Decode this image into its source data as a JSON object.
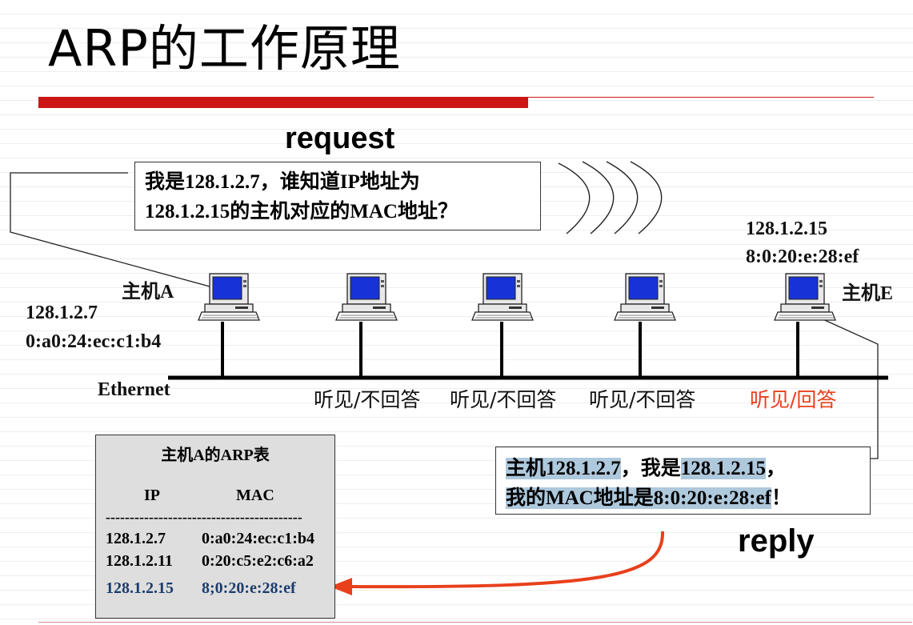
{
  "title": "ARP的工作原理",
  "request_label": "request",
  "reply_label": "reply",
  "request_message": {
    "line1": "我是128.1.2.7，谁知道IP地址为",
    "line2": "128.1.2.15的主机对应的MAC地址？"
  },
  "reply_message": {
    "line1_parts": [
      "主机128.1.2.7",
      "，我是",
      "128.1.2.15",
      "，"
    ],
    "line2_parts": [
      "我的",
      "MAC",
      "地址是",
      "8:0:20:e:28:ef",
      "！"
    ]
  },
  "host_a": {
    "name": "主机A",
    "ip": "128.1.2.7",
    "mac": "0:a0:24:ec:c1:b4"
  },
  "host_e": {
    "name": "主机E",
    "ip": "128.1.2.15",
    "mac": "8:0:20:e:28:ef"
  },
  "network_label": "Ethernet",
  "responses": [
    "听见/不回答",
    "听见/不回答",
    "听见/不回答",
    "听见/回答"
  ],
  "arp_table": {
    "title": "主机A的ARP表",
    "columns": [
      "IP",
      "MAC"
    ],
    "separator": "-----------------------------------------",
    "rows": [
      {
        "ip": "128.1.2.7",
        "mac": "0:a0:24:ec:c1:b4"
      },
      {
        "ip": "128.1.2.11",
        "mac": "0:20:c5:e2:c6:a2"
      },
      {
        "ip": "128.1.2.15",
        "mac": "8;0:20:e:28:ef"
      }
    ]
  },
  "colors": {
    "accent_red": "#cc1616",
    "highlight": "#aec8dc",
    "answer_red": "#e8401c",
    "table_new_row": "#1b3d6e"
  }
}
